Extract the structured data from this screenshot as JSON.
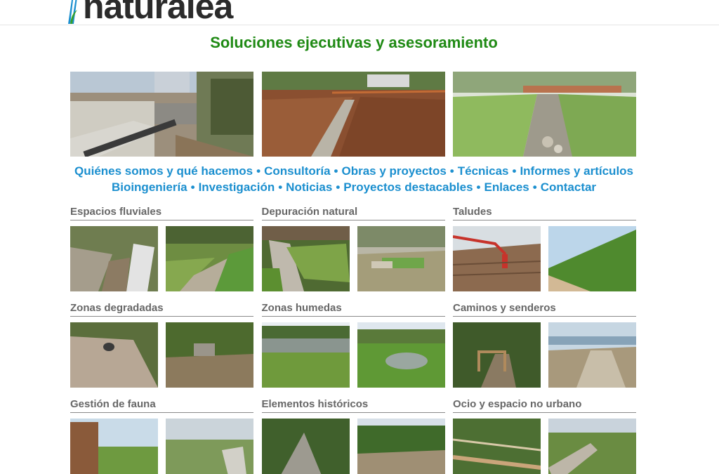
{
  "brand": {
    "logo_text": "naturalea"
  },
  "tagline": "Soluciones ejecutivas y asesoramiento",
  "hero": {
    "photos": [
      {
        "icon": "river-construction-photo"
      },
      {
        "icon": "excavated-channel-photo"
      },
      {
        "icon": "restored-river-bridge-photo"
      }
    ]
  },
  "nav": {
    "separator": "•",
    "line1": [
      "Quiénes somos y qué hacemos",
      "Consultoría",
      "Obras y proyectos",
      "Técnicas",
      "Informes y artículos"
    ],
    "line2": [
      "Bioingeniería",
      "Investigación",
      "Noticias",
      "Proyectos destacables",
      "Enlaces",
      "Contactar"
    ]
  },
  "categories": [
    {
      "title": "Espacios fluviales"
    },
    {
      "title": "Depuración natural"
    },
    {
      "title": "Taludes"
    },
    {
      "title": "Zonas degradadas"
    },
    {
      "title": "Zonas humedas"
    },
    {
      "title": "Caminos y senderos"
    },
    {
      "title": "Gestión de fauna"
    },
    {
      "title": "Elementos históricos"
    },
    {
      "title": "Ocio y espacio no urbano"
    }
  ],
  "colors": {
    "tagline": "#1f8a14",
    "nav_link": "#1b8fcf",
    "category_title": "#676767",
    "logo_text": "#2b2b2b",
    "logo_mark": "#1b8fcf",
    "logo_leaf": "#35a02b"
  }
}
